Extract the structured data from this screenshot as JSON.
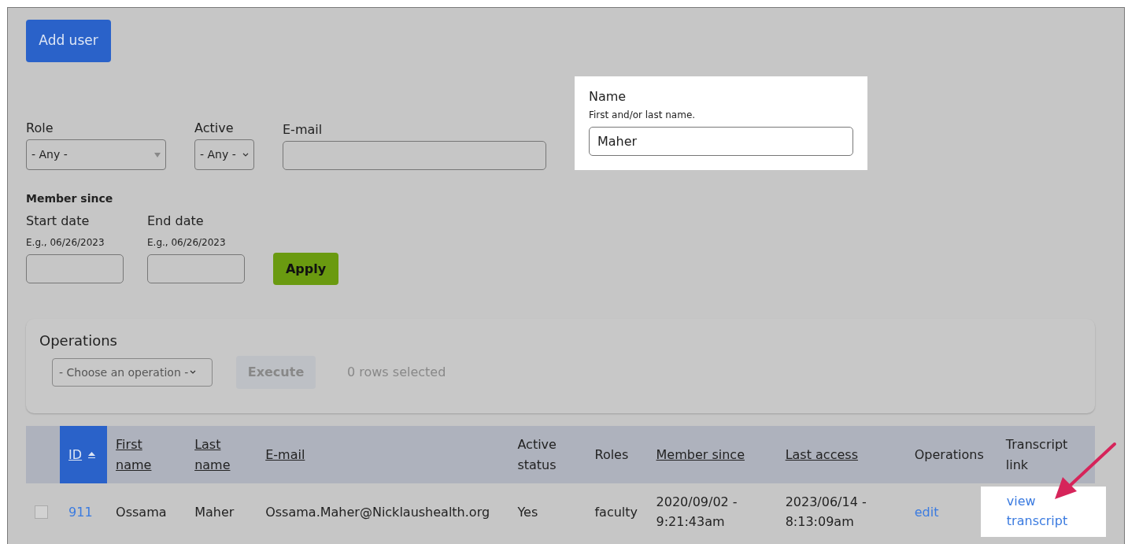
{
  "add_button": {
    "label": "Add user"
  },
  "filters": [
    {
      "kind": "select",
      "label": "Role",
      "value": "- Any -",
      "highlighted": false
    },
    {
      "kind": "select",
      "label": "Active",
      "value": "- Any -",
      "highlighted": false
    },
    {
      "kind": "text",
      "label": "E-mail",
      "highlighted": false
    },
    {
      "kind": "text",
      "label": "Name",
      "description": "First and/or last name.",
      "value": "Maher",
      "highlighted": true
    }
  ],
  "member_since": {
    "title": "Member since",
    "fields": [
      {
        "label": "Start date",
        "description": "E.g., 06/26/2023"
      },
      {
        "label": "End date",
        "description": "E.g., 06/26/2023"
      }
    ]
  },
  "apply_button": {
    "label": "Apply"
  },
  "operations": {
    "title": "Operations",
    "select": "- Choose an operation -",
    "execute": {
      "label": "Execute",
      "disabled": true
    },
    "status": "0 rows selected"
  },
  "table": {
    "columns": [
      {
        "kind": "checkbox"
      },
      {
        "label": "ID",
        "sortable": true,
        "selected": true
      },
      {
        "label": "First name",
        "sortable": true,
        "selected": false
      },
      {
        "label": "Last name",
        "sortable": true,
        "selected": false
      },
      {
        "label": "E-mail",
        "sortable": true,
        "selected": false
      },
      {
        "label": "Active status",
        "sortable": false,
        "selected": false
      },
      {
        "label": "Roles",
        "sortable": false,
        "selected": false
      },
      {
        "label": "Member since",
        "sortable": true,
        "selected": false
      },
      {
        "label": "Last access",
        "sortable": true,
        "selected": false
      },
      {
        "label": "Operations",
        "sortable": false,
        "selected": false
      },
      {
        "label": "Transcript link",
        "sortable": false,
        "selected": false
      }
    ],
    "rows": [
      {
        "cells": [
          {
            "kind": "checkbox",
            "checked": false
          },
          {
            "kind": "link",
            "text": "911"
          },
          {
            "kind": "text",
            "text": "Ossama"
          },
          {
            "kind": "text",
            "text": "Maher"
          },
          {
            "kind": "text",
            "text": "Ossama.Maher@Nicklaushealth.org"
          },
          {
            "kind": "text",
            "text": "Yes"
          },
          {
            "kind": "text",
            "text": "faculty"
          },
          {
            "kind": "text",
            "text": "2020/09/02 - 9:21:43am"
          },
          {
            "kind": "text",
            "text": "2023/06/14 - 8:13:09am"
          },
          {
            "kind": "link",
            "text": "edit"
          },
          {
            "kind": "link",
            "text": "view transcript",
            "highlighted": true
          }
        ]
      }
    ]
  }
}
